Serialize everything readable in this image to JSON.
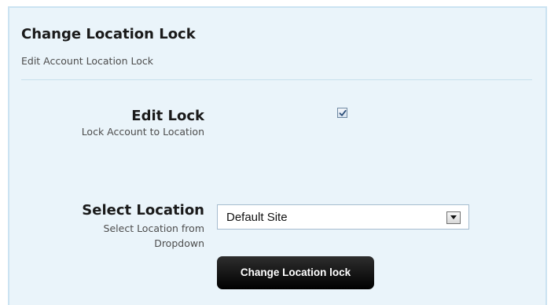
{
  "panel": {
    "title": "Change Location Lock",
    "subtitle": "Edit Account Location Lock"
  },
  "edit_lock": {
    "label": "Edit Lock",
    "description": "Lock Account to Location",
    "checked": true,
    "icon": "checkmark-icon"
  },
  "select_location": {
    "label": "Select Location",
    "description": "Select Location from Dropdown",
    "selected_value": "Default Site",
    "arrow_icon": "chevron-down-icon"
  },
  "actions": {
    "submit_label": "Change Location lock"
  }
}
